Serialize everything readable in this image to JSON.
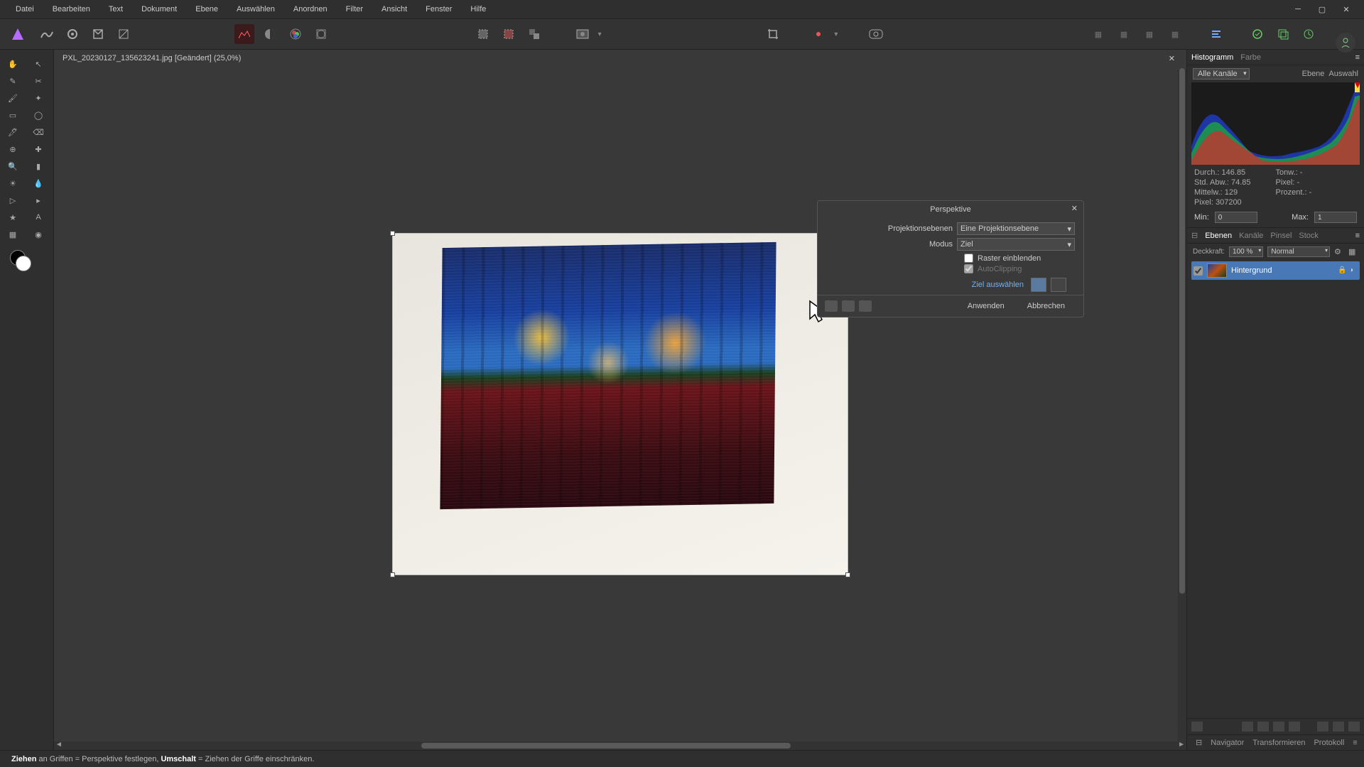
{
  "menu": [
    "Datei",
    "Bearbeiten",
    "Text",
    "Dokument",
    "Ebene",
    "Auswählen",
    "Anordnen",
    "Filter",
    "Ansicht",
    "Fenster",
    "Hilfe"
  ],
  "document": {
    "title": "PXL_20230127_135623241.jpg [Geändert] (25,0%)"
  },
  "dialog": {
    "title": "Perspektive",
    "projection_label": "Projektionsebenen",
    "projection_value": "Eine Projektionsebene",
    "mode_label": "Modus",
    "mode_value": "Ziel",
    "show_grid": "Raster einblenden",
    "autoclipping": "AutoClipping",
    "select_target": "Ziel auswählen",
    "apply": "Anwenden",
    "cancel": "Abbrechen"
  },
  "histogram": {
    "tabs": [
      "Histogramm",
      "Farbe"
    ],
    "channels": "Alle Kanäle",
    "pill_layer": "Ebene",
    "pill_selection": "Auswahl",
    "stats": {
      "mean_label": "Durch.:",
      "mean": "146.85",
      "std_label": "Std. Abw.:",
      "std": "74.85",
      "median_label": "Mittelw.:",
      "median": "129",
      "pixels_label": "Pixel:",
      "pixels": "307200",
      "tone_label": "Tonw.:",
      "tone": "-",
      "pixpct_label": "Pixel:",
      "pixpct": "-",
      "pct_label": "Prozent.:",
      "pct": "-"
    },
    "min_label": "Min:",
    "min": "0",
    "max_label": "Max:",
    "max": "1"
  },
  "layers": {
    "tabs": [
      "Ebenen",
      "Kanäle",
      "Pinsel",
      "Stock"
    ],
    "opacity_label": "Deckkraft:",
    "opacity_value": "100 %",
    "blend_mode": "Normal",
    "layer_name": "Hintergrund",
    "bottom_tabs": [
      "Navigator",
      "Transformieren",
      "Protokoll"
    ]
  },
  "status": {
    "prefix_bold": "Ziehen",
    "prefix_rest": " an Griffen = Perspektive festlegen, ",
    "mid_bold": "Umschalt",
    "mid_rest": " = Ziehen der Griffe einschränken."
  }
}
